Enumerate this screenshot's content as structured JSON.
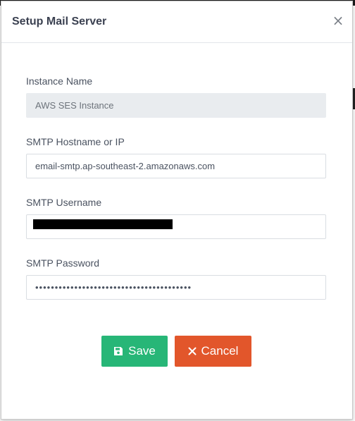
{
  "modal": {
    "title": "Setup Mail Server",
    "close_glyph": "×"
  },
  "fields": {
    "instance_name": {
      "label": "Instance Name",
      "value": "AWS SES Instance"
    },
    "smtp_host": {
      "label": "SMTP Hostname or IP",
      "value": "email-smtp.ap-southeast-2.amazonaws.com"
    },
    "smtp_username": {
      "label": "SMTP Username",
      "value": ""
    },
    "smtp_password": {
      "label": "SMTP Password",
      "value": "••••••••••••••••••••••••••••••••••••••••"
    }
  },
  "buttons": {
    "save_label": "Save",
    "save_icon": "floppy-disk-icon",
    "cancel_label": "Cancel",
    "cancel_icon": "x-icon"
  },
  "colors": {
    "save": "#27b677",
    "cancel": "#e2562b",
    "readonly_bg": "#e9ecef"
  }
}
